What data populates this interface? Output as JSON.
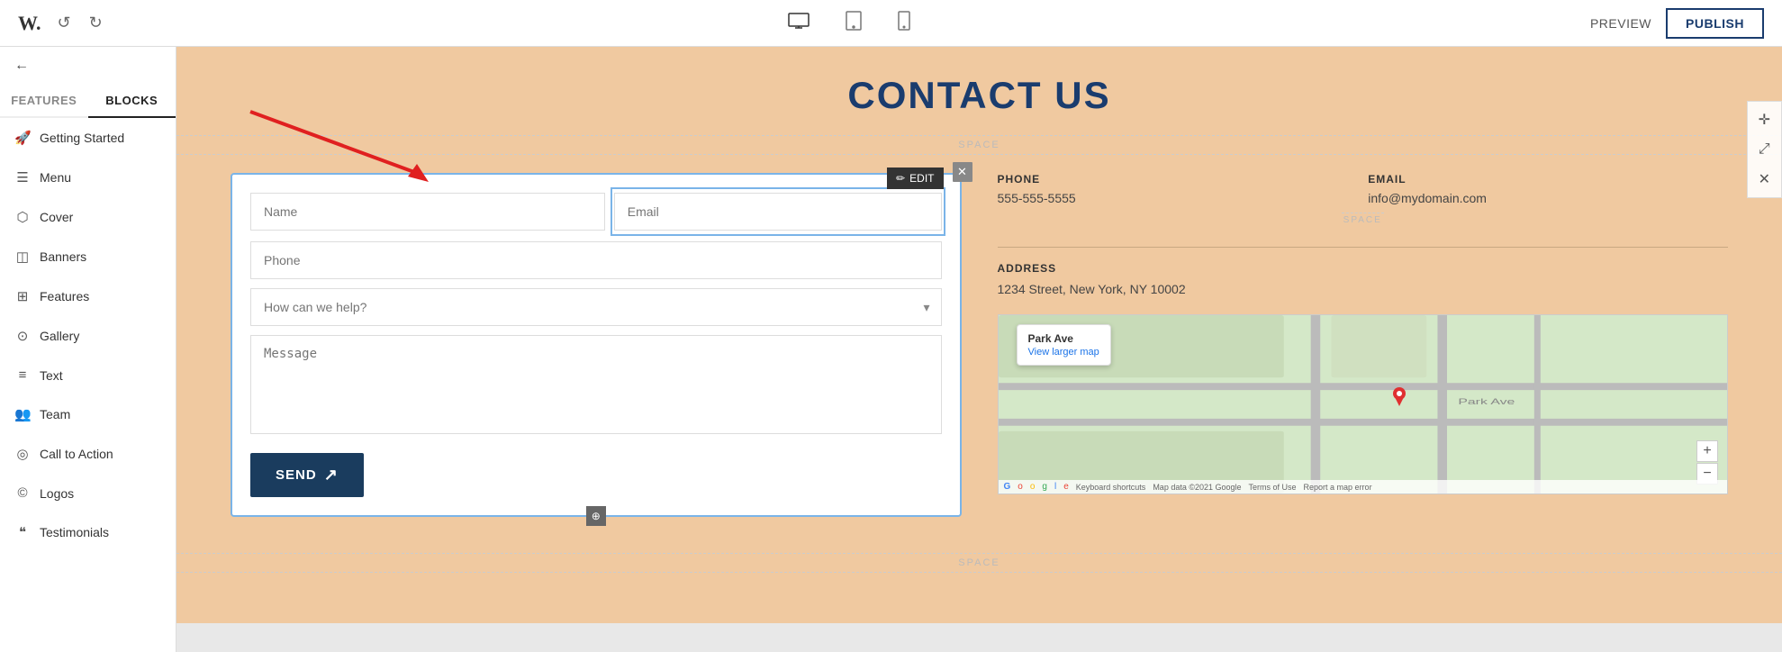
{
  "topbar": {
    "logo": "W.",
    "undo_label": "↺",
    "redo_label": "↻",
    "device_desktop": "□",
    "device_tablet": "⬜",
    "device_mobile": "▭",
    "preview_label": "PREVIEW",
    "publish_label": "PUBLISH"
  },
  "sidebar": {
    "features_tab": "FEATURES",
    "blocks_tab": "BLOCKS",
    "items": [
      {
        "id": "getting-started",
        "icon": "🚀",
        "label": "Getting Started"
      },
      {
        "id": "menu",
        "icon": "☰",
        "label": "Menu"
      },
      {
        "id": "cover",
        "icon": "⬡",
        "label": "Cover"
      },
      {
        "id": "banners",
        "icon": "◫",
        "label": "Banners"
      },
      {
        "id": "features",
        "icon": "⊞",
        "label": "Features"
      },
      {
        "id": "gallery",
        "icon": "⊙",
        "label": "Gallery"
      },
      {
        "id": "text",
        "icon": "≡",
        "label": "Text"
      },
      {
        "id": "team",
        "icon": "👥",
        "label": "Team"
      },
      {
        "id": "call-to-action",
        "icon": "◎",
        "label": "Call to Action"
      },
      {
        "id": "logos",
        "icon": "©",
        "label": "Logos"
      },
      {
        "id": "testimonials",
        "icon": "❝",
        "label": "Testimonials"
      }
    ]
  },
  "canvas": {
    "page_title": "CONTACT US",
    "space_label": "SPACE",
    "form": {
      "name_placeholder": "Name",
      "email_placeholder": "Email",
      "phone_placeholder": "Phone",
      "dropdown_placeholder": "How can we help?",
      "message_placeholder": "Message",
      "send_label": "SEND",
      "edit_label": "EDIT"
    },
    "contact": {
      "phone_label": "PHONE",
      "phone_value": "555-555-5555",
      "email_label": "EMAIL",
      "email_value": "info@mydomain.com",
      "address_label": "ADDRESS",
      "address_value": "1234 Street, New York, NY 10002"
    },
    "map": {
      "popup_title": "Park Ave",
      "popup_link": "View larger map",
      "zoom_in": "+",
      "zoom_out": "−",
      "footer_keyboard": "Keyboard shortcuts",
      "footer_data": "Map data ©2021 Google",
      "footer_terms": "Terms of Use",
      "footer_report": "Report a map error"
    }
  }
}
